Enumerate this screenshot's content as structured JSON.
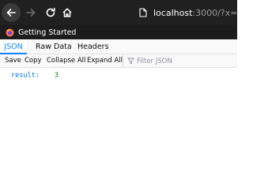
{
  "browser": {
    "url_host": "localhost",
    "url_rest": ":3000/?x=1&y",
    "bookmark_label": "Getting Started"
  },
  "viewer": {
    "tabs": [
      "JSON",
      "Raw Data",
      "Headers"
    ],
    "actions": {
      "save": "Save",
      "copy": "Copy",
      "collapse": "Collapse All",
      "expand": "Expand All"
    },
    "filter_placeholder": "Filter JSON"
  },
  "json": {
    "key": "result:",
    "value": "3"
  },
  "colors": {
    "accent": "#0a84ff",
    "json_key": "#0074e8",
    "json_number": "#058b00"
  }
}
